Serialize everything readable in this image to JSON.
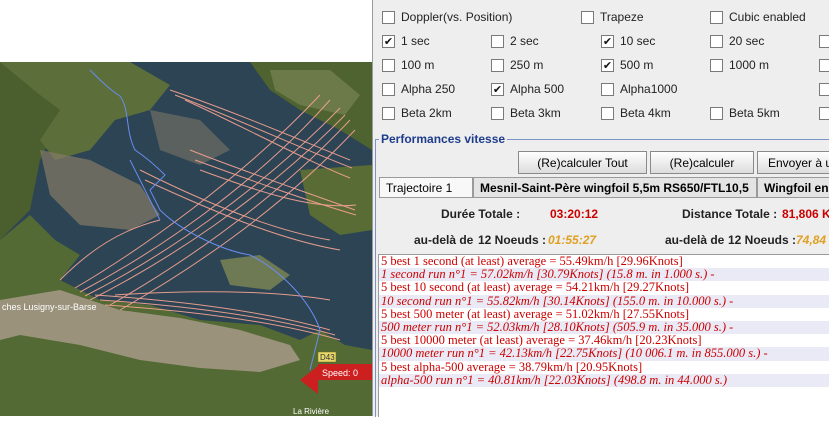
{
  "map": {
    "place_label": "ches Lusigny-sur-Barse",
    "road_label": "D43",
    "speed_label": "Speed: 0",
    "town_label": "La Rivière"
  },
  "options": [
    {
      "label": "Doppler(vs. Position)",
      "checked": false
    },
    {
      "label": "Trapeze",
      "checked": false
    },
    {
      "label": "Cubic enabled",
      "checked": false
    },
    {
      "label": "1 sec",
      "checked": true
    },
    {
      "label": "2 sec",
      "checked": false
    },
    {
      "label": "10 sec",
      "checked": true
    },
    {
      "label": "20 sec",
      "checked": false
    },
    {
      "label": "100 m",
      "checked": false
    },
    {
      "label": "250 m",
      "checked": false
    },
    {
      "label": "500 m",
      "checked": true
    },
    {
      "label": "1000 m",
      "checked": false
    },
    {
      "label": "Alpha 250",
      "checked": false
    },
    {
      "label": "Alpha 500",
      "checked": true
    },
    {
      "label": "Alpha1000",
      "checked": false
    },
    {
      "label": "Beta 2km",
      "checked": false
    },
    {
      "label": "Beta 3km",
      "checked": false
    },
    {
      "label": "Beta 4km",
      "checked": false
    },
    {
      "label": "Beta 5km",
      "checked": false
    }
  ],
  "check_mark": "✔",
  "section_title": "Performances vitesse",
  "buttons": {
    "recalc_all": "(Re)calculer Tout",
    "recalc": "(Re)calculer",
    "send": "Envoyer à u"
  },
  "tabs": [
    "Trajectoire 1",
    "Mesnil-Saint-Père wingfoil 5,5m RS650/FTL10,5",
    "Wingfoil en"
  ],
  "stats": {
    "duration_label": "Durée Totale :",
    "duration_value": "03:20:12",
    "distance_label": "Distance Totale :",
    "distance_value": "81,806 K",
    "beyond_label_1": "au-delà de",
    "beyond_knots_1": "12 Noeuds :",
    "beyond_time": "01:55:27",
    "beyond_label_2": "au-delà de",
    "beyond_knots_2": "12 Noeuds :",
    "beyond_dist": "74,84"
  },
  "colors": {
    "red": "#cc0000",
    "orange": "#e0a020",
    "blue_title": "#1e3c8c"
  },
  "results": [
    "5 best 1 second (at least) average = 55.49km/h [29.96Knots]",
    "1 second run n°1 = 57.02km/h [30.79Knots] (15.8 m. in 1.000 s.) -",
    "5 best 10 second (at least) average = 54.21km/h [29.27Knots]",
    "10 second run n°1 = 55.82km/h [30.14Knots] (155.0 m. in 10.000 s.) -",
    "5 best 500 meter (at least) average = 51.02km/h [27.55Knots]",
    "500 meter run n°1 = 52.03km/h [28.10Knots] (505.9 m. in 35.000 s.) -",
    "5 best 10000 meter (at least) average = 37.46km/h [20.23Knots]",
    "10000 meter run n°1 = 42.13km/h [22.75Knots] (10 006.1 m. in 855.000 s.) -",
    "5 best alpha-500 average = 38.79km/h [20.95Knots]",
    "alpha-500 run n°1 = 40.81km/h [22.03Knots] (498.8 m. in 44.000 s.)"
  ]
}
